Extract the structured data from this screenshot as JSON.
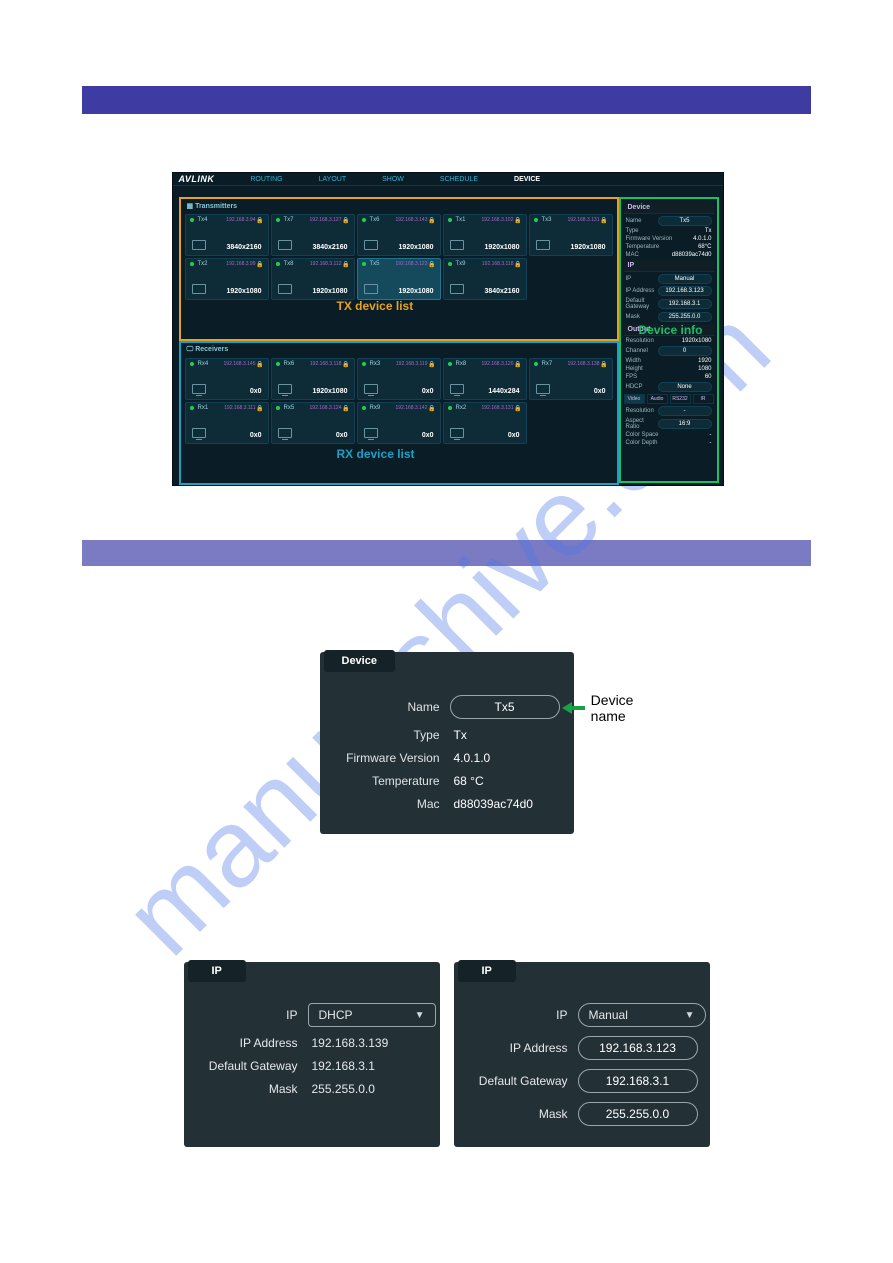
{
  "bars": {},
  "watermark": "manualshive.com",
  "shot": {
    "brand": "AVLINK",
    "tabs": [
      "ROUTING",
      "LAYOUT",
      "SHOW",
      "SCHEDULE",
      "DEVICE"
    ],
    "active_tab": "DEVICE",
    "tx_header": "Transmitters",
    "rx_header": "Receivers",
    "tx_label": "TX device list",
    "rx_label": "RX device list",
    "info_label": "Device info",
    "tx_tiles": [
      {
        "name": "Tx4",
        "ip": "192.168.3.94",
        "res": "3840x2160"
      },
      {
        "name": "Tx7",
        "ip": "192.168.3.127",
        "res": "3840x2160"
      },
      {
        "name": "Tx6",
        "ip": "192.168.3.143",
        "res": "1920x1080"
      },
      {
        "name": "Tx1",
        "ip": "192.168.3.102",
        "res": "1920x1080"
      },
      {
        "name": "Tx3",
        "ip": "192.168.3.131",
        "res": "1920x1080"
      },
      {
        "name": "Tx2",
        "ip": "192.168.3.99",
        "res": "1920x1080"
      },
      {
        "name": "Tx8",
        "ip": "192.168.3.112",
        "res": "1920x1080"
      },
      {
        "name": "Tx5",
        "ip": "192.168.3.123",
        "res": "1920x1080",
        "active": true
      },
      {
        "name": "Tx9",
        "ip": "192.168.3.118",
        "res": "3840x2160"
      }
    ],
    "rx_tiles": [
      {
        "name": "Rx4",
        "ip": "192.168.3.145",
        "res": "0x0"
      },
      {
        "name": "Rx6",
        "ip": "192.168.3.118",
        "res": "1920x1080"
      },
      {
        "name": "Rx3",
        "ip": "192.168.3.119",
        "res": "0x0"
      },
      {
        "name": "Rx8",
        "ip": "192.168.3.120",
        "res": "1440x284"
      },
      {
        "name": "Rx7",
        "ip": "192.168.3.138",
        "res": "0x0"
      },
      {
        "name": "Rx1",
        "ip": "192.168.3.111",
        "res": "0x0"
      },
      {
        "name": "Rx5",
        "ip": "192.168.3.124",
        "res": "0x0"
      },
      {
        "name": "Rx9",
        "ip": "192.168.3.142",
        "res": "0x0"
      },
      {
        "name": "Rx2",
        "ip": "192.168.3.131",
        "res": "0x0"
      }
    ],
    "side": {
      "device_tab": "Device",
      "name_label": "Name",
      "name_value": "Tx5",
      "type_label": "Type",
      "type_value": "Tx",
      "fw_label": "Firmware Version",
      "fw_value": "4.0.1.0",
      "temp_label": "Temperature",
      "temp_value": "68°C",
      "mac_label": "MAC",
      "mac_value": "d88039ac74d0",
      "ip_tab": "IP",
      "ip_mode_label": "IP",
      "ip_mode_value": "Manual",
      "ip_addr_label": "IP Address",
      "ip_addr_value": "192.168.3.123",
      "gw_label": "Default Gateway",
      "gw_value": "192.168.3.1",
      "mask_label": "Mask",
      "mask_value": "255.255.0.0",
      "output_tab": "Output",
      "res_label": "Resolution",
      "res_value": "1920x1080",
      "ch_label": "Channel",
      "ch_value": "0",
      "w_label": "Width",
      "w_value": "1920",
      "h_label": "Height",
      "h_value": "1080",
      "fps_label": "FPS",
      "fps_value": "60",
      "hdcp_label": "HDCP",
      "hdcp_value": "None",
      "sub_tabs": [
        "Video",
        "Audio",
        "RS232",
        "IR"
      ],
      "resln_label": "Resolution",
      "resln_value": "-",
      "ar_label": "Aspect Ratio",
      "ar_value": "16:9",
      "cs_label": "Color Space",
      "cs_value": "-",
      "cd_label": "Color Depth",
      "cd_value": "-"
    }
  },
  "card": {
    "tab": "Device",
    "name_label": "Name",
    "name_value": "Tx5",
    "type_label": "Type",
    "type_value": "Tx",
    "fw_label": "Firmware Version",
    "fw_value": "4.0.1.0",
    "temp_label": "Temperature",
    "temp_value": "68 °C",
    "mac_label": "Mac",
    "mac_value": "d88039ac74d0",
    "callout": "Device name"
  },
  "ip1": {
    "tab": "IP",
    "mode_label": "IP",
    "mode_value": "DHCP",
    "addr_label": "IP Address",
    "addr_value": "192.168.3.139",
    "gw_label": "Default Gateway",
    "gw_value": "192.168.3.1",
    "mask_label": "Mask",
    "mask_value": "255.255.0.0"
  },
  "ip2": {
    "tab": "IP",
    "mode_label": "IP",
    "mode_value": "Manual",
    "addr_label": "IP Address",
    "addr_value": "192.168.3.123",
    "gw_label": "Default Gateway",
    "gw_value": "192.168.3.1",
    "mask_label": "Mask",
    "mask_value": "255.255.0.0"
  }
}
